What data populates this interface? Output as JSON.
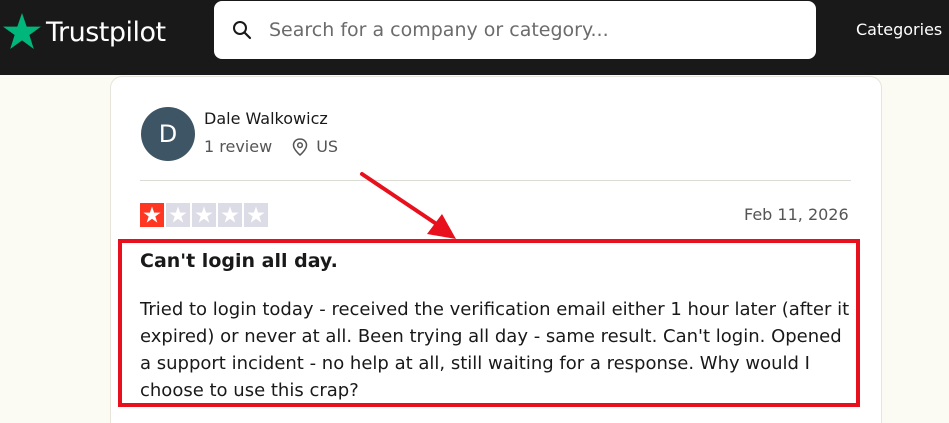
{
  "header": {
    "logo_text": "Trustpilot",
    "search_placeholder": "Search for a company or category...",
    "nav_categories": "Categories"
  },
  "review": {
    "avatar_initial": "D",
    "reviewer_name": "Dale Walkowicz",
    "review_count": "1 review",
    "location": "US",
    "rating": 1,
    "max_rating": 5,
    "date": "Feb 11, 2026",
    "title": "Can't login all day.",
    "body": "Tried to login today - received the verification email either 1 hour later (after it expired) or never at all.  Been trying all day - same result.  Can't login.  Opened a support incident - no help at all, still waiting for a response.  Why would I choose to use this crap?"
  },
  "colors": {
    "brand_green": "#00b67a",
    "star_red": "#ff3722",
    "highlight_red": "#e8101c",
    "topbar": "#191919"
  },
  "icons": {
    "logo": "star-icon",
    "search": "search-icon",
    "location": "location-pin-icon"
  }
}
